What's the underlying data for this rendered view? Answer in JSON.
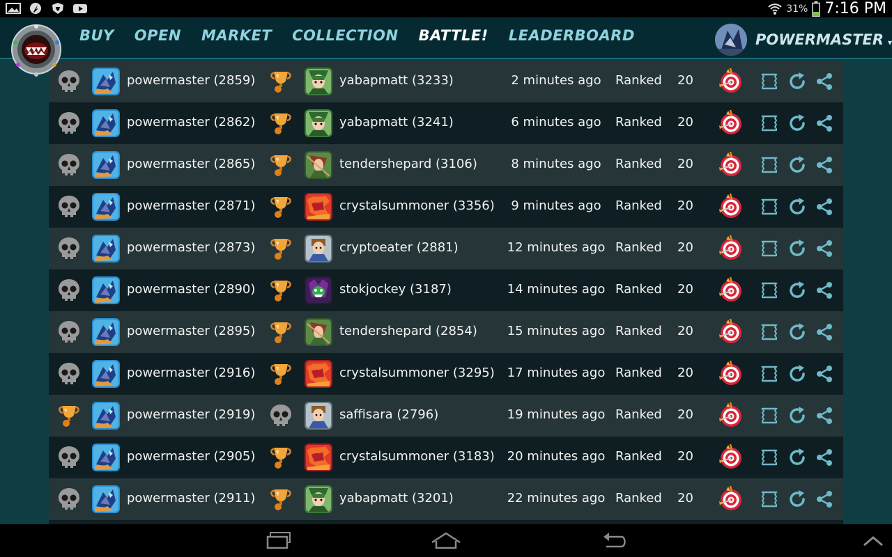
{
  "status_bar": {
    "battery_percent": "31%",
    "time": "7:16 PM",
    "icons": [
      "gallery-icon",
      "feather-icon",
      "brave-lion-icon",
      "youtube-icon"
    ]
  },
  "nav": {
    "items": [
      {
        "label": "BUY",
        "active": false
      },
      {
        "label": "OPEN",
        "active": false
      },
      {
        "label": "MARKET",
        "active": false
      },
      {
        "label": "COLLECTION",
        "active": false
      },
      {
        "label": "BATTLE!",
        "active": true
      },
      {
        "label": "LEADERBOARD",
        "active": false
      }
    ],
    "user": {
      "name": "POWERMASTER",
      "caret": "▾"
    }
  },
  "battles": [
    {
      "p1_result": "loss",
      "p1": "powermaster (2859)",
      "p2_result": "win",
      "p2_avatar": "green-hero",
      "p2": "yabapmatt (3233)",
      "time": "2 minutes ago",
      "mode": "Ranked",
      "mana": "20"
    },
    {
      "p1_result": "loss",
      "p1": "powermaster (2862)",
      "p2_result": "win",
      "p2_avatar": "green-hero",
      "p2": "yabapmatt (3241)",
      "time": "6 minutes ago",
      "mode": "Ranked",
      "mana": "20"
    },
    {
      "p1_result": "loss",
      "p1": "powermaster (2865)",
      "p2_result": "win",
      "p2_avatar": "elf-archer",
      "p2": "tendershepard (3106)",
      "time": "8 minutes ago",
      "mode": "Ranked",
      "mana": "20"
    },
    {
      "p1_result": "loss",
      "p1": "powermaster (2871)",
      "p2_result": "win",
      "p2_avatar": "red-dragon",
      "p2": "crystalsummoner (3356)",
      "time": "9 minutes ago",
      "mode": "Ranked",
      "mana": "20"
    },
    {
      "p1_result": "loss",
      "p1": "powermaster (2873)",
      "p2_result": "win",
      "p2_avatar": "noble",
      "p2": "cryptoeater (2881)",
      "time": "12 minutes ago",
      "mode": "Ranked",
      "mana": "20"
    },
    {
      "p1_result": "loss",
      "p1": "powermaster (2890)",
      "p2_result": "win",
      "p2_avatar": "dark-monster",
      "p2": "stokjockey (3187)",
      "time": "14 minutes ago",
      "mode": "Ranked",
      "mana": "20"
    },
    {
      "p1_result": "loss",
      "p1": "powermaster (2895)",
      "p2_result": "win",
      "p2_avatar": "elf-archer",
      "p2": "tendershepard (2854)",
      "time": "15 minutes ago",
      "mode": "Ranked",
      "mana": "20"
    },
    {
      "p1_result": "loss",
      "p1": "powermaster (2916)",
      "p2_result": "win",
      "p2_avatar": "red-dragon",
      "p2": "crystalsummoner (3295)",
      "time": "17 minutes ago",
      "mode": "Ranked",
      "mana": "20"
    },
    {
      "p1_result": "win",
      "p1": "powermaster (2919)",
      "p2_result": "loss",
      "p2_avatar": "noble",
      "p2": "saffisara (2796)",
      "time": "19 minutes ago",
      "mode": "Ranked",
      "mana": "20"
    },
    {
      "p1_result": "loss",
      "p1": "powermaster (2905)",
      "p2_result": "win",
      "p2_avatar": "red-dragon",
      "p2": "crystalsummoner (3183)",
      "time": "20 minutes ago",
      "mode": "Ranked",
      "mana": "20"
    },
    {
      "p1_result": "loss",
      "p1": "powermaster (2911)",
      "p2_result": "win",
      "p2_avatar": "green-hero",
      "p2": "yabapmatt (3201)",
      "time": "22 minutes ago",
      "mode": "Ranked",
      "mana": "20"
    }
  ],
  "colors": {
    "nav_bg": "#062a31",
    "app_bg": "#0f3d44",
    "row_odd": "#253538",
    "row_even": "#0e1e22",
    "nav_text": "#8fd2df",
    "action_icon": "#6fb9c8",
    "trophy": "#e58a1e",
    "target_red": "#d8263a"
  }
}
